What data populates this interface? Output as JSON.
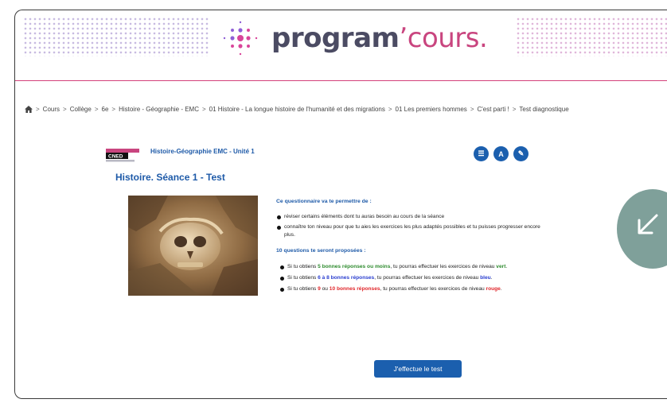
{
  "header": {
    "logo_main": "program",
    "logo_apostrophe": "’",
    "logo_accent": "cours.",
    "colors": {
      "primary": "#4b4b63",
      "accent": "#c9457f",
      "line": "#d4417a"
    }
  },
  "breadcrumb": {
    "home_icon": "home-icon",
    "items": [
      "Cours",
      "Collège",
      "6e",
      "Histoire - Géographie - EMC",
      "01 Histoire - La longue histoire de l'humanité et des migrations",
      "01 Les premiers hommes",
      "C'est parti !",
      "Test diagnostique"
    ],
    "separator": ">"
  },
  "course": {
    "cned_label": "CNED",
    "unit_title": "Histoire-Géographie EMC - Unité 1",
    "page_title": "Histoire. Séance 1 - Test",
    "tool_icons": [
      "list-icon",
      "dictionary-icon",
      "tools-icon"
    ],
    "tool_icon_glyphs": [
      "☰",
      "A",
      "✎"
    ],
    "accent_color": "#1b5fae"
  },
  "content": {
    "intro": "Ce questionnaire va te permettre de :",
    "intro_items": [
      "réviser certains éléments dont tu auras besoin au cours de la séance",
      "connaître ton niveau pour que tu aies les exercices les plus adaptés possibles et tu puisses progresser encore plus."
    ],
    "questions_heading": "10 questions te seront proposées :",
    "rules": [
      {
        "pre": "Si tu obtiens ",
        "highlight": "5 bonnes réponses ou moins",
        "mid": ", tu pourras effectuer les exercices de niveau ",
        "level": "vert",
        "post": ".",
        "color": "green"
      },
      {
        "pre": "Si tu obtiens  ",
        "highlight": "6 à 8 bonnes réponses",
        "mid": ", tu pourras effectuer les exercices de niveau ",
        "level": "bleu",
        "post": ".",
        "color": "blue"
      },
      {
        "pre": "Si tu obtiens ",
        "highlight": "9",
        "join": " ou ",
        "highlight2": "10 bonnes réponses",
        "mid": ", tu pourras effectuer les exercices de niveau ",
        "level": "rouge",
        "post": ".",
        "color": "red"
      }
    ]
  },
  "actions": {
    "start_test_label": "J'effectue le test"
  },
  "side": {
    "arrow_icon": "arrow-down-left-icon",
    "color": "#7fa09a"
  }
}
